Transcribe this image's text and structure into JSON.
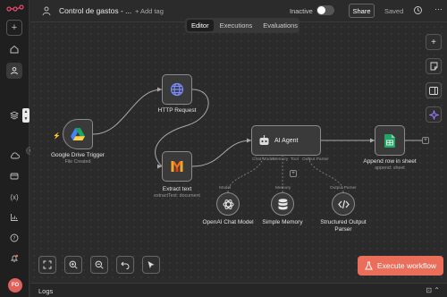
{
  "topbar": {
    "title": "Control de gastos - ...",
    "add_tag": "+ Add tag",
    "status": "Inactive",
    "share": "Share",
    "saved": "Saved"
  },
  "tabs": [
    {
      "label": "Editor",
      "active": true
    },
    {
      "label": "Executions",
      "active": false
    },
    {
      "label": "Evaluations",
      "active": false
    }
  ],
  "nodes": {
    "trigger": {
      "label": "Google Drive Trigger",
      "sub": "File Created"
    },
    "http": {
      "label": "HTTP Request"
    },
    "extract": {
      "label": "Extract text",
      "sub": "extractText: document"
    },
    "agent": {
      "label": "AI Agent"
    },
    "append": {
      "label": "Append row in sheet",
      "sub": "append: sheet"
    },
    "openai": {
      "label": "OpenAI Chat Model",
      "port": "Model"
    },
    "memory": {
      "label": "Simple Memory",
      "port": "Memory"
    },
    "parser": {
      "label": "Structured Output Parser",
      "port": "Output Parser"
    },
    "agent_ports": {
      "model": "Chat Model",
      "memory": "Memory",
      "tool": "Tool",
      "parser": "Output Parser"
    }
  },
  "actions": {
    "execute": "Execute workflow"
  },
  "logs": {
    "label": "Logs"
  },
  "sidebar": {
    "avatar": "FO"
  },
  "colors": {
    "accent": "#ea6e5a",
    "node_border": "#8a8a8a",
    "canvas": "#2b2b2b"
  }
}
